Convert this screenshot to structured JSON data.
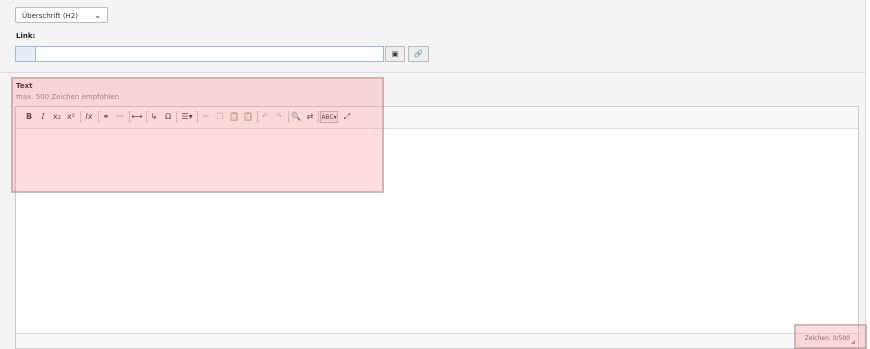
{
  "heading_select": {
    "value": "Überschrift (H2)",
    "chevron": "chevron-down-icon"
  },
  "link": {
    "label": "Link:",
    "browse_icon": "page-browse-icon",
    "link_icon": "link-icon"
  },
  "text": {
    "label": "Text",
    "hint": "max. 500 Zeichen empfohlen"
  },
  "toolbar": {
    "bold": "B",
    "italic": "I",
    "subscript": "x₂",
    "superscript": "x²",
    "remove_format": "Ix",
    "link": "⚭",
    "unlink": "⚯",
    "anchor": "⟷",
    "soft_hyphen": "↳",
    "special_char": "Ω",
    "format": "☰▾",
    "cut": "✂",
    "copy": "❐",
    "paste": "📋",
    "paste_text": "📋",
    "undo": "↶",
    "redo": "↷",
    "find": "🔍",
    "replace": "⇄",
    "spellcheck": "ABC▾",
    "maximize": "⤢"
  },
  "counter": {
    "text": "Zeichen: 0/500"
  },
  "colors": {
    "highlight": "#ff7878",
    "link_border": "#99bbdd"
  }
}
